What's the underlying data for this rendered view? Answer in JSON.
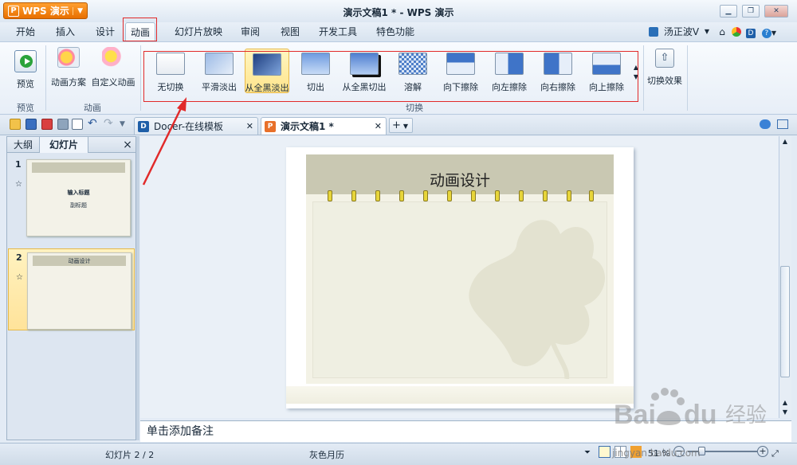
{
  "app": {
    "button_label": "WPS 演示",
    "window_title": "演示文稿1 * - WPS 演示",
    "window_controls": [
      "minimize-icon",
      "restore-icon",
      "close-icon"
    ]
  },
  "menu": {
    "tabs": [
      "开始",
      "插入",
      "设计",
      "动画",
      "幻灯片放映",
      "审阅",
      "视图",
      "开发工具",
      "特色功能"
    ],
    "active_tab": "动画",
    "user": "汤正波V"
  },
  "ribbon": {
    "preview_label": "预览",
    "preview_group": "预览",
    "anim_scheme_label": "动画方案",
    "custom_anim_label": "自定义动画",
    "anim_group": "动画",
    "transitions": [
      "无切换",
      "平滑淡出",
      "从全黑淡出",
      "切出",
      "从全黑切出",
      "溶解",
      "向下擦除",
      "向左擦除",
      "向右擦除",
      "向上擦除"
    ],
    "selected_transition": "从全黑淡出",
    "transition_group": "切换",
    "effect_label": "切换效果"
  },
  "doc_tabs": [
    {
      "label": "Docer-在线模板",
      "icon": "docer-icon"
    },
    {
      "label": "演示文稿1 *",
      "icon": "presentation-icon"
    }
  ],
  "left_panel": {
    "tab_outline": "大纲",
    "tab_slides": "幻灯片",
    "close": "×",
    "slides": [
      {
        "num": "1",
        "anim_mark": "☆",
        "title": "输入标题",
        "subtitle": "副标题"
      },
      {
        "num": "2",
        "anim_mark": "☆",
        "title": "动画设计"
      }
    ]
  },
  "slide": {
    "title": "动画设计"
  },
  "notes_placeholder": "单击添加备注",
  "status": {
    "slide_info": "幻灯片 2 / 2",
    "theme": "灰色月历",
    "zoom": "51 %",
    "zoom_level": 0.51
  },
  "watermark": {
    "text": "Baidu经验",
    "url": "jingyan.baidu.com"
  },
  "colors": {
    "accent_orange": "#f07a00",
    "highlight_red": "#e12a2a",
    "selected_yellow": "#ffe48a"
  }
}
